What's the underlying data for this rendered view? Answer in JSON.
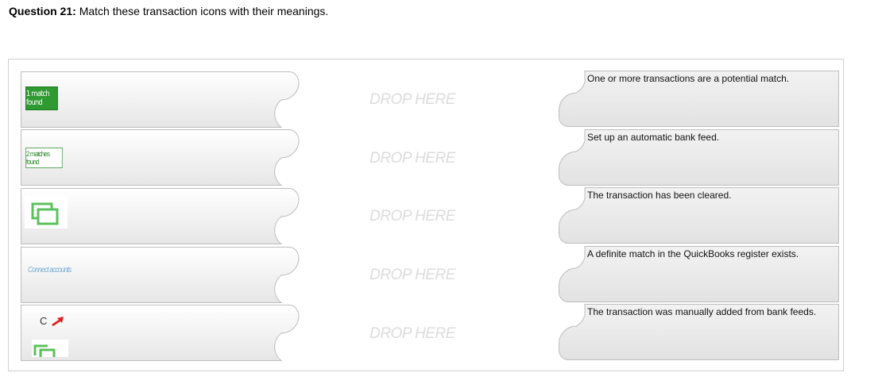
{
  "question": {
    "label": "Question 21:",
    "text": "Match these transaction icons with their meanings."
  },
  "left_items": [
    {
      "icon": "match-found-icon",
      "icon_text": "1 match found"
    },
    {
      "icon": "matches-found-icon",
      "icon_text": "2 matches found"
    },
    {
      "icon": "stacked-windows-icon",
      "icon_text": ""
    },
    {
      "icon": "connect-accounts-icon",
      "icon_text": "Connect accounts"
    },
    {
      "icon": "cleared-c-icon",
      "icon_text": "C"
    }
  ],
  "drop_label": "DROP HERE",
  "right_items": [
    "One or more transactions are a potential match.",
    "Set up an automatic bank feed.",
    "The transaction has been cleared.",
    "A definite match in the QuickBooks register exists.",
    "The transaction was manually added from bank feeds."
  ],
  "colors": {
    "tile_fill_top": "#ffffff",
    "tile_fill_bottom": "#e9e9e9",
    "tile_border": "#bdbdbd",
    "drop_text": "#dcdcdc",
    "accent_green": "#2f9a31",
    "arrow_red": "#e02020"
  }
}
